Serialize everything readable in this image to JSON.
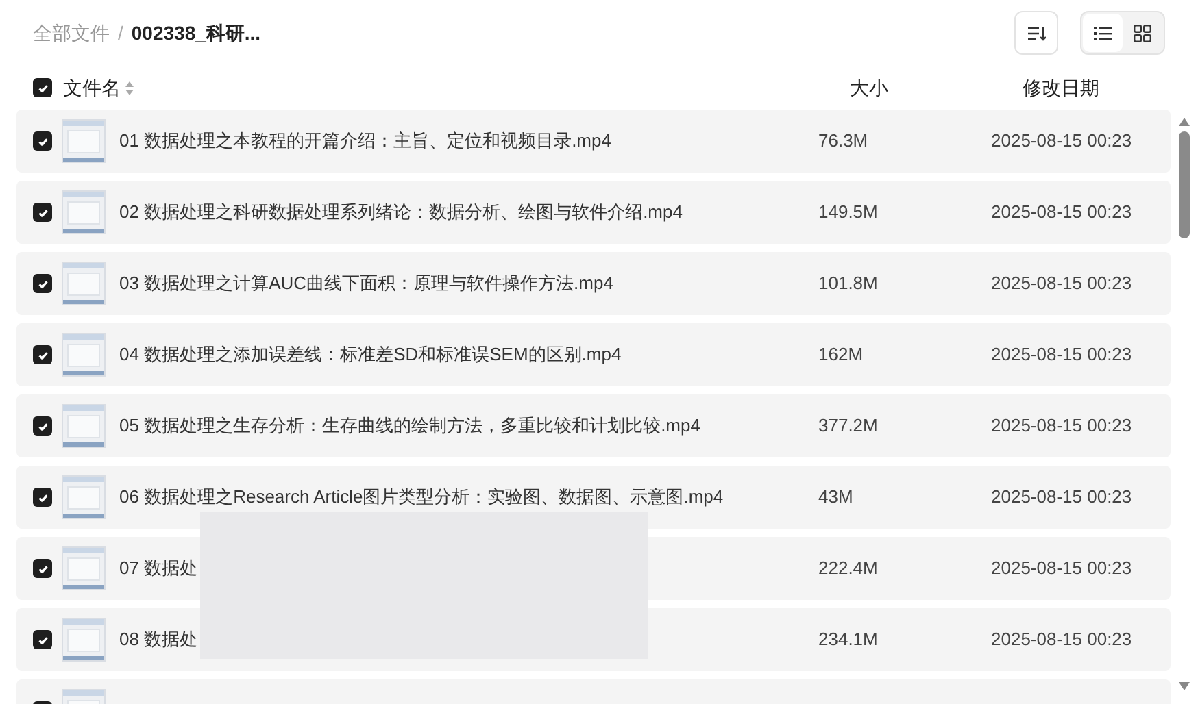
{
  "breadcrumb": {
    "root": "全部文件",
    "separator": "/",
    "current": "002338_科研..."
  },
  "view_toggle": [
    {
      "kind": "list",
      "selected": true
    },
    {
      "kind": "grid",
      "selected": false
    }
  ],
  "header": {
    "checked": true,
    "columns": [
      "文件名",
      "大小",
      "修改日期"
    ]
  },
  "rows": [
    {
      "checked": true,
      "name": "01 数据处理之本教程的开篇介绍：主旨、定位和视频目录.mp4",
      "size": "76.3M",
      "date": "2025-08-15 00:23"
    },
    {
      "checked": true,
      "name": "02 数据处理之科研数据处理系列绪论：数据分析、绘图与软件介绍.mp4",
      "size": "149.5M",
      "date": "2025-08-15 00:23"
    },
    {
      "checked": true,
      "name": "03 数据处理之计算AUC曲线下面积：原理与软件操作方法.mp4",
      "size": "101.8M",
      "date": "2025-08-15 00:23"
    },
    {
      "checked": true,
      "name": "04 数据处理之添加误差线：标准差SD和标准误SEM的区别.mp4",
      "size": "162M",
      "date": "2025-08-15 00:23"
    },
    {
      "checked": true,
      "name": "05 数据处理之生存分析：生存曲线的绘制方法，多重比较和计划比较.mp4",
      "size": "377.2M",
      "date": "2025-08-15 00:23"
    },
    {
      "checked": true,
      "name": "06 数据处理之Research Article图片类型分析：实验图、数据图、示意图.mp4",
      "size": "43M",
      "date": "2025-08-15 00:23"
    },
    {
      "checked": true,
      "name": "07 数据处",
      "size": "222.4M",
      "date": "2025-08-15 00:23"
    },
    {
      "checked": true,
      "name": "08 数据处",
      "size": "234.1M",
      "date": "2025-08-15 00:23"
    },
    {
      "checked": true
    }
  ]
}
